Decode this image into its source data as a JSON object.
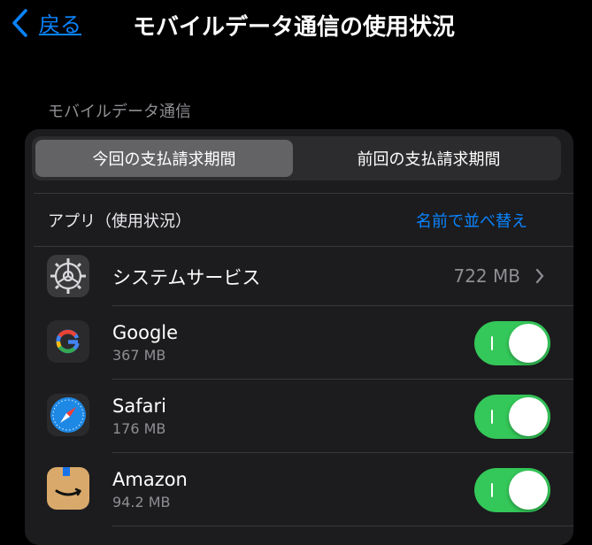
{
  "nav": {
    "back_label": "戻る",
    "title": "モバイルデータ通信の使用状況"
  },
  "section": {
    "label": "モバイルデータ通信"
  },
  "segmented": {
    "current_period": "今回の支払請求期間",
    "previous_period": "前回の支払請求期間",
    "selected": "current_period"
  },
  "list_header": {
    "left": "アプリ（使用状況）",
    "sort_label": "名前で並べ替え"
  },
  "apps": [
    {
      "name": "システムサービス",
      "usage": "722 MB",
      "icon": "gear-icon",
      "has_toggle": false
    },
    {
      "name": "Google",
      "usage": "367 MB",
      "icon": "google-icon",
      "toggle_on": true
    },
    {
      "name": "Safari",
      "usage": "176 MB",
      "icon": "safari-compass-icon",
      "toggle_on": true
    },
    {
      "name": "Amazon",
      "usage": "94.2 MB",
      "icon": "amazon-icon",
      "toggle_on": true
    }
  ],
  "colors": {
    "accent": "#0a84ff",
    "toggle_on": "#34c759",
    "card": "#1c1c1e"
  }
}
